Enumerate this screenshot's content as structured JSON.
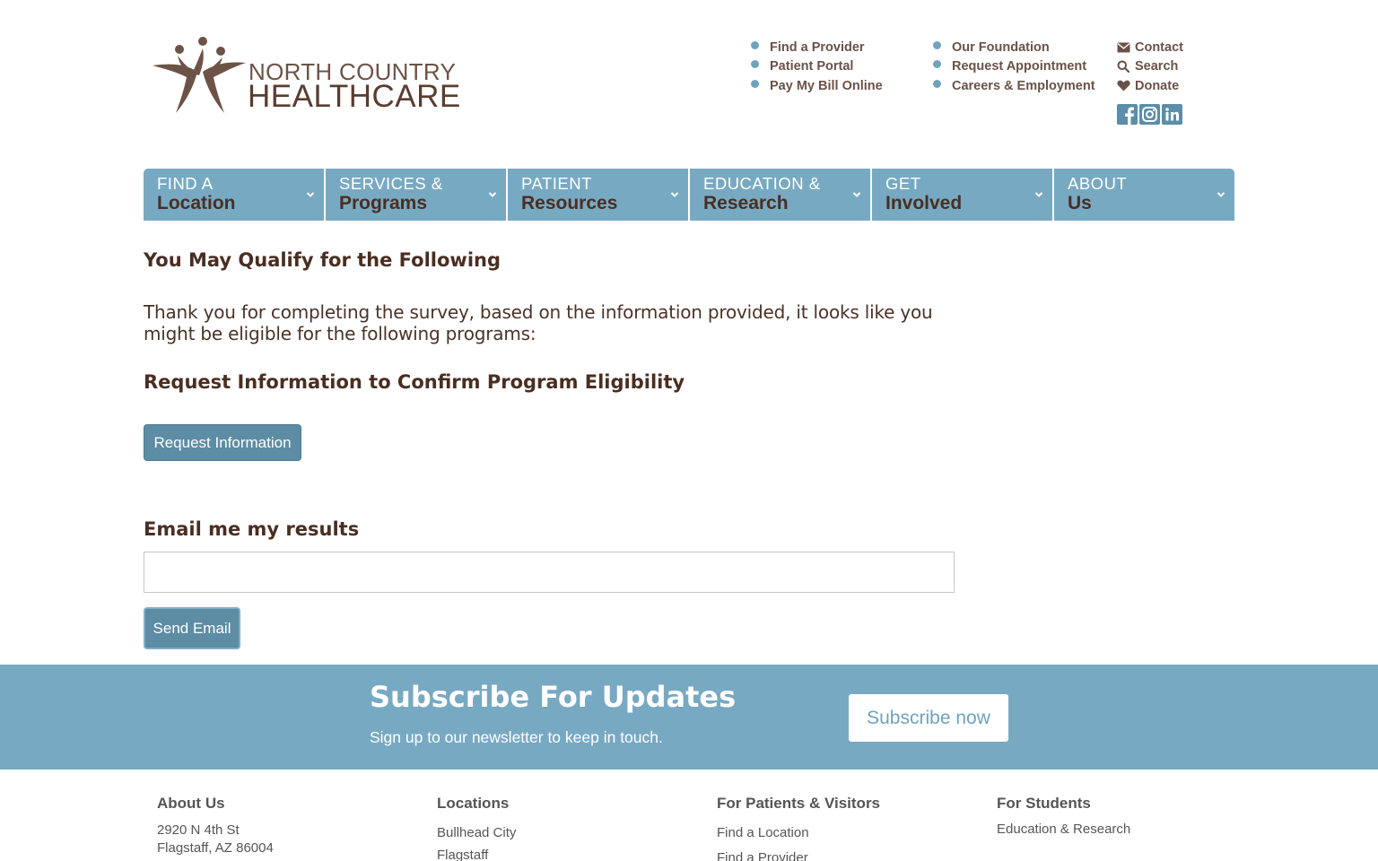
{
  "header": {
    "logo": {
      "line1": "NORTH COUNTRY",
      "line2": "HEALTHCARE"
    },
    "utility_col1": [
      {
        "label": "Find a Provider"
      },
      {
        "label": "Patient Portal"
      },
      {
        "label": "Pay My Bill Online"
      }
    ],
    "utility_col2": [
      {
        "label": "Our Foundation"
      },
      {
        "label": "Request Appointment"
      },
      {
        "label": "Careers & Employment"
      }
    ],
    "utility_col3": [
      {
        "label": "Contact",
        "icon": "envelope-icon"
      },
      {
        "label": "Search",
        "icon": "search-icon"
      },
      {
        "label": "Donate",
        "icon": "heart-icon"
      }
    ],
    "social": [
      "facebook-icon",
      "instagram-icon",
      "linkedin-icon"
    ]
  },
  "nav": {
    "items": [
      {
        "top": "FIND A",
        "bottom": "Location"
      },
      {
        "top": "SERVICES &",
        "bottom": "Programs"
      },
      {
        "top": "PATIENT",
        "bottom": "Resources"
      },
      {
        "top": "EDUCATION &",
        "bottom": "Research"
      },
      {
        "top": "GET",
        "bottom": "Involved"
      },
      {
        "top": "ABOUT",
        "bottom": "Us"
      }
    ]
  },
  "main": {
    "qualify_heading": "You May Qualify for the Following",
    "thanks_text": "Thank you for completing the survey, based on the information provided, it looks like you might be eligible for the following programs:",
    "request_heading": "Request Information to Confirm Program Eligibility",
    "request_button": "Request Information",
    "email_heading": "Email me my results",
    "email_value": "",
    "send_button": "Send Email"
  },
  "subscribe": {
    "title": "Subscribe For Updates",
    "text": "Sign up to our newsletter to keep in touch.",
    "button": "Subscribe now"
  },
  "footer": {
    "about": {
      "heading": "About Us",
      "address1": "2920 N 4th St",
      "address2": "Flagstaff, AZ 86004"
    },
    "locations": {
      "heading": "Locations",
      "links": [
        "Bullhead City",
        "Flagstaff"
      ]
    },
    "patients": {
      "heading": "For Patients & Visitors",
      "links": [
        "Find a Location",
        "Find a Provider"
      ]
    },
    "students": {
      "heading": "For Students",
      "links": [
        "Education & Research"
      ]
    }
  },
  "colors": {
    "brand_blue": "#78a9c2",
    "button_blue": "#5d8ca5",
    "brand_brown": "#4a2e22",
    "logo_brown": "#6d5347"
  }
}
